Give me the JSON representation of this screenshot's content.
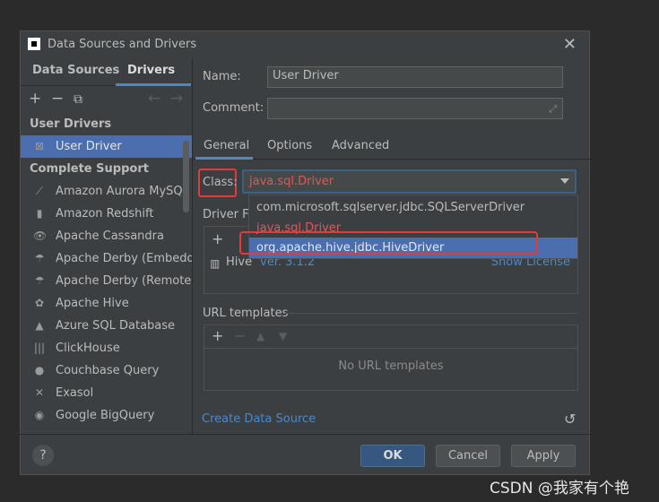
{
  "window": {
    "title": "Data Sources and Drivers",
    "close_glyph": "✕"
  },
  "left_tabs": {
    "data_sources": "Data Sources",
    "drivers": "Drivers"
  },
  "toolbar": {
    "add": "+",
    "remove": "−",
    "copy": "⧉",
    "back": "←",
    "forward": "→"
  },
  "groups": {
    "user": "User Drivers",
    "complete": "Complete Support"
  },
  "user_drivers": [
    {
      "label": "User Driver",
      "icon": "user-driver-icon",
      "glyph": "⊠"
    }
  ],
  "drivers": [
    {
      "label": "Amazon Aurora MySQL",
      "icon": "aurora-icon",
      "glyph": "⟋"
    },
    {
      "label": "Amazon Redshift",
      "icon": "redshift-icon",
      "glyph": "▮"
    },
    {
      "label": "Apache Cassandra",
      "icon": "cassandra-icon",
      "glyph": "👁"
    },
    {
      "label": "Apache Derby (Embedded)",
      "icon": "derby-icon",
      "glyph": "☂"
    },
    {
      "label": "Apache Derby (Remote)",
      "icon": "derby-remote-icon",
      "glyph": "☂"
    },
    {
      "label": "Apache Hive",
      "icon": "hive-icon",
      "glyph": "✿"
    },
    {
      "label": "Azure SQL Database",
      "icon": "azure-icon",
      "glyph": "▲"
    },
    {
      "label": "ClickHouse",
      "icon": "clickhouse-icon",
      "glyph": "|||"
    },
    {
      "label": "Couchbase Query",
      "icon": "couchbase-icon",
      "glyph": "●"
    },
    {
      "label": "Exasol",
      "icon": "exasol-icon",
      "glyph": "✕"
    },
    {
      "label": "Google BigQuery",
      "icon": "bigquery-icon",
      "glyph": "◉"
    }
  ],
  "form": {
    "name_label": "Name:",
    "name_value": "User Driver",
    "comment_label": "Comment:",
    "comment_value": ""
  },
  "right_tabs": {
    "general": "General",
    "options": "Options",
    "advanced": "Advanced"
  },
  "class_field": {
    "label": "Class:",
    "value": "java.sql.Driver"
  },
  "class_dropdown": [
    "com.microsoft.sqlserver.jdbc.SQLServerDriver",
    "java.sql.Driver",
    "org.apache.hive.jdbc.HiveDriver"
  ],
  "driver_files": {
    "label": "Driver F",
    "add": "+",
    "item_name": "Hive",
    "item_version": "ver. 3.1.2",
    "license_link": "Show License"
  },
  "url_templates": {
    "label": "URL templates",
    "add": "+",
    "remove": "−",
    "up": "▲",
    "down": "▼",
    "empty": "No URL templates"
  },
  "create_link": "Create Data Source",
  "undo_glyph": "↺",
  "buttons": {
    "help": "?",
    "ok": "OK",
    "cancel": "Cancel",
    "apply": "Apply"
  },
  "watermark": "CSDN @我家有个艳",
  "colors": {
    "selection": "#4b6eaf",
    "link": "#4a88c7",
    "highlight_red": "#e23b3b",
    "error_text": "#e05757"
  }
}
